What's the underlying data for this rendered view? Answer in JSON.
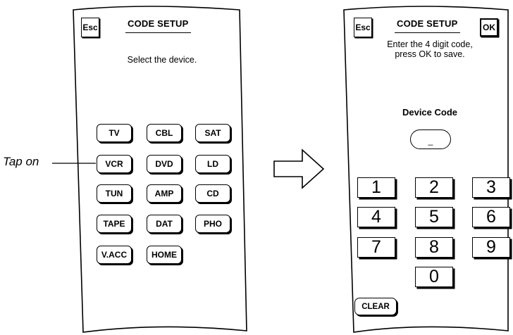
{
  "left_screen": {
    "esc_label": "Esc",
    "title": "CODE SETUP",
    "instruction": "Select the device.",
    "devices": [
      "TV",
      "CBL",
      "SAT",
      "VCR",
      "DVD",
      "LD",
      "TUN",
      "AMP",
      "CD",
      "TAPE",
      "DAT",
      "PHO",
      "V.ACC",
      "HOME"
    ]
  },
  "annotation": {
    "tap_label": "Tap on"
  },
  "right_screen": {
    "esc_label": "Esc",
    "title": "CODE SETUP",
    "ok_label": "OK",
    "instruction_line1": "Enter the 4 digit code,",
    "instruction_line2": "press OK to save.",
    "device_code_label": "Device Code",
    "device_code_value": "_",
    "keys": [
      "1",
      "2",
      "3",
      "4",
      "5",
      "6",
      "7",
      "8",
      "9",
      "0"
    ],
    "clear_label": "CLEAR"
  }
}
